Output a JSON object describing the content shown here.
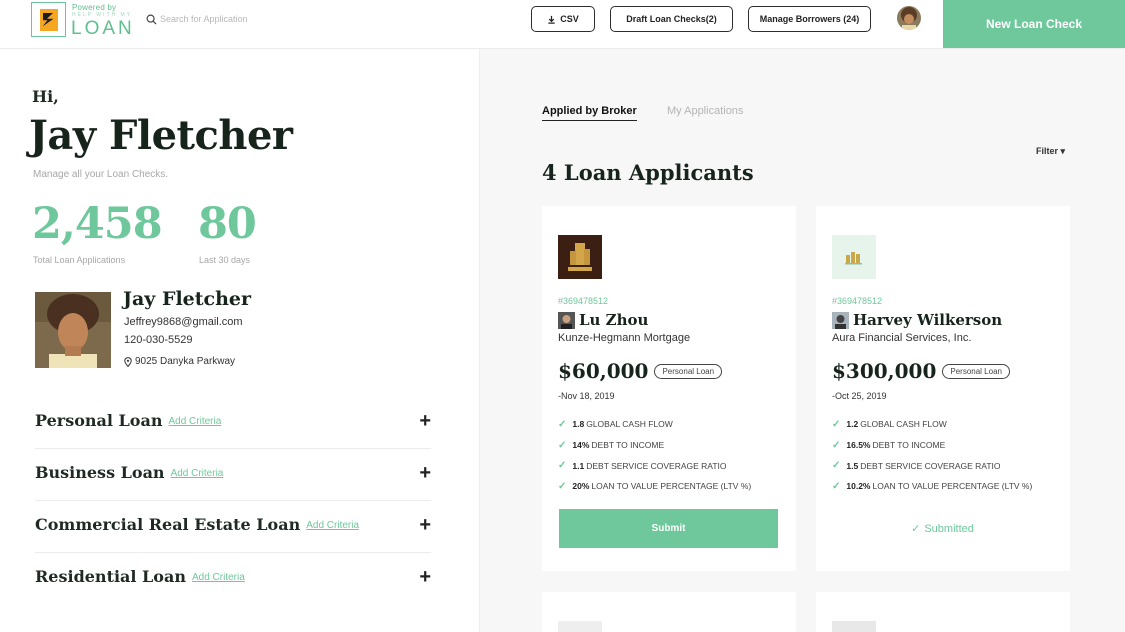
{
  "header": {
    "powered_by": "Powered by",
    "tagline": "HELP WITH MY",
    "brand": "LOAN",
    "search_placeholder": "Search for Application",
    "csv_label": "CSV",
    "draft_label": "Draft Loan Checks(2)",
    "borrowers_label": "Manage Borrowers (24)",
    "new_loan_label": "New Loan Check"
  },
  "greeting": {
    "hi": "Hi,",
    "name": "Jay Fletcher",
    "subtitle": "Manage all your Loan Checks."
  },
  "stats": [
    {
      "value": "2,458",
      "label": "Total Loan Applications"
    },
    {
      "value": "80",
      "label": "Last 30 days"
    }
  ],
  "profile": {
    "name": "Jay Fletcher",
    "email": "Jeffrey9868@gmail.com",
    "phone": "120-030-5529",
    "address": "9025 Danyka Parkway"
  },
  "loan_types": [
    {
      "title": "Personal Loan",
      "action": "Add Criteria"
    },
    {
      "title": "Business Loan",
      "action": "Add Criteria"
    },
    {
      "title": "Commercial Real Estate Loan",
      "action": "Add Criteria"
    },
    {
      "title": "Residential Loan",
      "action": "Add Criteria"
    }
  ],
  "tabs": {
    "active": "Applied by Broker",
    "inactive": "My Applications"
  },
  "filter_label": "Filter",
  "applicants_title": "4 Loan Applicants",
  "applicants": [
    {
      "id": "#369478512",
      "name": "Lu Zhou",
      "company": "Kunze-Hegmann Mortgage",
      "amount": "$60,000",
      "loan_type": "Personal Loan",
      "date": "-Nov 18, 2019",
      "metrics": [
        {
          "value": "1.8",
          "label": "GLOBAL CASH FLOW"
        },
        {
          "value": "14%",
          "label": "DEBT TO INCOME"
        },
        {
          "value": "1.1",
          "label": "DEBT SERVICE COVERAGE RATIO"
        },
        {
          "value": "20%",
          "label": "LOAN TO VALUE PERCENTAGE (LTV %)"
        }
      ],
      "action_label": "Submit"
    },
    {
      "id": "#369478512",
      "name": "Harvey Wilkerson",
      "company": "Aura Financial Services, Inc.",
      "amount": "$300,000",
      "loan_type": "Personal Loan",
      "date": "-Oct 25, 2019",
      "metrics": [
        {
          "value": "1.2",
          "label": "GLOBAL CASH FLOW"
        },
        {
          "value": "16.5%",
          "label": "DEBT TO INCOME"
        },
        {
          "value": "1.5",
          "label": "DEBT SERVICE COVERAGE RATIO"
        },
        {
          "value": "10.2%",
          "label": "LOAN TO VALUE PERCENTAGE (LTV %)"
        }
      ],
      "status_label": "Submitted"
    }
  ],
  "colors": {
    "accent": "#6ec89b",
    "dark_text": "#17241c",
    "panel_bg": "#f7f7f7"
  }
}
